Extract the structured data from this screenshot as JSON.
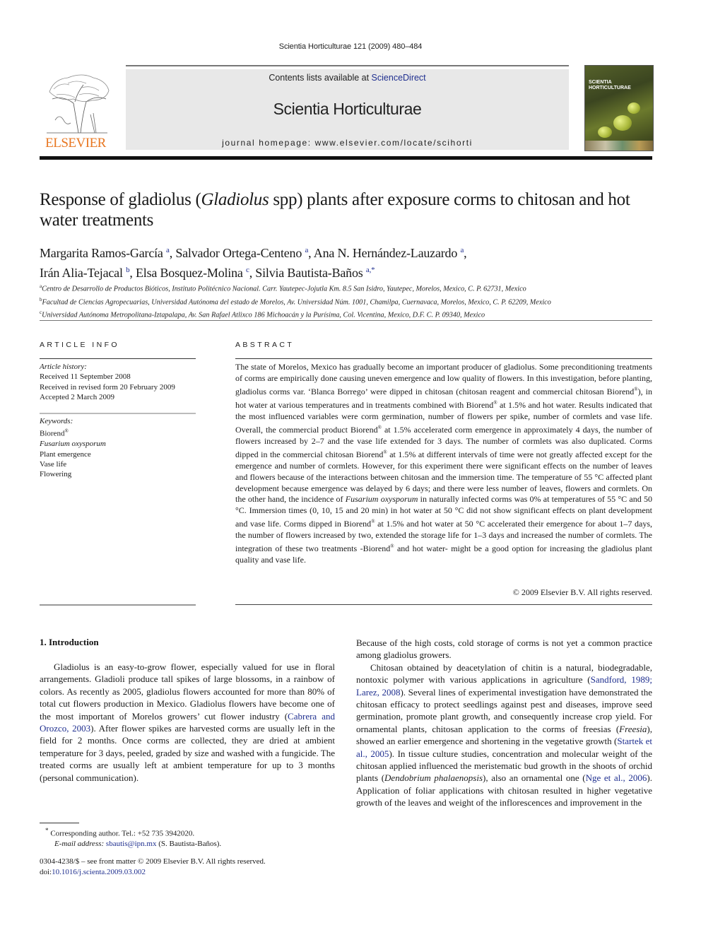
{
  "running_head": "Scientia Horticulturae 121 (2009) 480–484",
  "masthead": {
    "contents_prefix": "Contents lists available at ",
    "contents_link": "ScienceDirect",
    "journal_title": "Scientia Horticulturae",
    "homepage": "journal homepage: www.elsevier.com/locate/scihorti",
    "publisher_logo_text": "ELSEVIER",
    "cover_title_line1": "SCIENTIA",
    "cover_title_line2": "HORTICULTURAE"
  },
  "colors": {
    "link": "#1f2f8f",
    "elsevier_orange": "#e87722",
    "masthead_band": "#e8e8e8"
  },
  "article": {
    "title_part1": "Response of gladiolus (",
    "title_italic": "Gladiolus",
    "title_part2": " spp) plants after exposure corms to chitosan and hot water treatments",
    "authors": [
      {
        "name": "Margarita Ramos-García",
        "aff": "a",
        "sep": ", "
      },
      {
        "name": "Salvador Ortega-Centeno",
        "aff": "a",
        "sep": ", "
      },
      {
        "name": "Ana N. Hernández-Lauzardo",
        "aff": "a",
        "sep": ","
      },
      {
        "name": "Irán Alia-Tejacal",
        "aff": "b",
        "sep": ", "
      },
      {
        "name": "Elsa Bosquez-Molina",
        "aff": "c",
        "sep": ", "
      },
      {
        "name": "Silvia Bautista-Baños",
        "aff": "a,*",
        "sep": ""
      }
    ],
    "affiliations": [
      {
        "key": "a",
        "text": "Centro de Desarrollo de Productos Bióticos, Instituto Politécnico Nacional. Carr. Yautepec-Jojutla Km. 8.5 San Isidro, Yautepec, Morelos, Mexico, C. P. 62731, Mexico"
      },
      {
        "key": "b",
        "text": "Facultad de Ciencias Agropecuarias, Universidad Autónoma del estado de Morelos, Av. Universidad Núm. 1001, Chamilpa, Cuernavaca, Morelos, Mexico, C. P. 62209, Mexico"
      },
      {
        "key": "c",
        "text": "Universidad Autónoma Metropolitana-Iztapalapa, Av. San Rafael Atlixco 186 Michoacán y la Purísima, Col. Vicentina, Mexico, D.F. C. P. 09340, Mexico"
      }
    ]
  },
  "article_info": {
    "label": "ARTICLE INFO",
    "history_label": "Article history:",
    "history": [
      "Received 11 September 2008",
      "Received in revised form 20 February 2009",
      "Accepted 2 March 2009"
    ],
    "keywords_label": "Keywords:",
    "keywords": [
      {
        "text": "Biorend",
        "reg": "®",
        "italic": false
      },
      {
        "text": "Fusarium oxysporum",
        "reg": "",
        "italic": true
      },
      {
        "text": "Plant emergence",
        "reg": "",
        "italic": false
      },
      {
        "text": "Vase life",
        "reg": "",
        "italic": false
      },
      {
        "text": "Flowering",
        "reg": "",
        "italic": false
      }
    ]
  },
  "abstract": {
    "label": "ABSTRACT",
    "segments": [
      {
        "t": "The state of Morelos, Mexico has gradually become an important producer of gladiolus. Some preconditioning treatments of corms are empirically done causing uneven emergence and low quality of flowers. In this investigation, before planting, gladiolus corms var. ‘Blanca Borrego’ were dipped in chitosan (chitosan reagent and commercial chitosan Biorend"
      },
      {
        "t": "®",
        "sup": true
      },
      {
        "t": "), in hot water at various temperatures and in treatments combined with Biorend"
      },
      {
        "t": "®",
        "sup": true
      },
      {
        "t": " at 1.5% and hot water. Results indicated that the most influenced variables were corm germination, number of flowers per spike, number of cormlets and vase life. Overall, the commercial product Biorend"
      },
      {
        "t": "®",
        "sup": true
      },
      {
        "t": " at 1.5% accelerated corm emergence in approximately 4 days, the number of flowers increased by 2–7 and the vase life extended for 3 days. The number of cormlets was also duplicated. Corms dipped in the commercial chitosan Biorend"
      },
      {
        "t": "®",
        "sup": true
      },
      {
        "t": " at 1.5% at different intervals of time were not greatly affected except for the emergence and number of cormlets. However, for this experiment there were significant effects on the number of leaves and flowers because of the interactions between chitosan and the immersion time. The temperature of 55 °C affected plant development because emergence was delayed by 6 days; and there were less number of leaves, flowers and cormlets. On the other hand, the incidence of "
      },
      {
        "t": "Fusarium oxysporum",
        "it": true
      },
      {
        "t": " in naturally infected corms was 0% at temperatures of 55 °C and 50 °C. Immersion times (0, 10, 15 and 20 min) in hot water at 50 °C did not show significant effects on plant development and vase life. Corms dipped in Biorend"
      },
      {
        "t": "®",
        "sup": true
      },
      {
        "t": " at 1.5% and hot water at 50 °C accelerated their emergence for about 1–7 days, the number of flowers increased by two, extended the storage life for 1–3 days and increased the number of cormlets. The integration of these two treatments -Biorend"
      },
      {
        "t": "®",
        "sup": true
      },
      {
        "t": " and hot water- might be a good option for increasing the gladiolus plant quality and vase life."
      }
    ],
    "copyright": "© 2009 Elsevier B.V. All rights reserved."
  },
  "body": {
    "intro_heading": "1.  Introduction",
    "left_column": [
      {
        "t": "Gladiolus is an easy-to-grow flower, especially valued for use in floral arrangements. Gladioli produce tall spikes of large blossoms, in a rainbow of colors. As recently as 2005, gladiolus flowers accounted for more than 80% of total cut flowers production in Mexico. Gladiolus flowers have become one of the most important of Morelos growers’ cut flower industry ("
      },
      {
        "t": "Cabrera and Orozco, 2003",
        "link": true
      },
      {
        "t": "). After flower spikes are harvested corms are usually left in the field for 2 months. Once corms are collected, they are dried at ambient temperature for 3 days, peeled, graded by size and washed with a fungicide. The treated corms are usually left at ambient temperature for up to 3 months (personal communication)."
      }
    ],
    "right_column_p1": "Because of the high costs, cold storage of corms is not yet a common practice among gladiolus growers.",
    "right_column_p2": [
      {
        "t": "Chitosan obtained by deacetylation of chitin is a natural, biodegradable, nontoxic polymer with various applications in agriculture ("
      },
      {
        "t": "Sandford, 1989; Larez, 2008",
        "link": true
      },
      {
        "t": "). Several lines of experimental investigation have demonstrated the chitosan efficacy to protect seedlings against pest and diseases, improve seed germination, promote plant growth, and consequently increase crop yield. For ornamental plants, chitosan application to the corms of freesias ("
      },
      {
        "t": "Freesia",
        "it": true
      },
      {
        "t": "), showed an earlier emergence and shortening in the vegetative growth ("
      },
      {
        "t": "Startek et al., 2005",
        "link": true
      },
      {
        "t": "). In tissue culture studies, concentration and molecular weight of the chitosan applied influenced the meristematic bud growth in the shoots of orchid plants ("
      },
      {
        "t": "Dendobrium phalaenopsis",
        "it": true
      },
      {
        "t": "), also an ornamental one ("
      },
      {
        "t": "Nge et al., 2006",
        "link": true
      },
      {
        "t": "). Application of foliar applications with chitosan resulted in higher vegetative growth of the leaves and weight of the inflorescences and improvement in the"
      }
    ]
  },
  "footnote": {
    "marker": "*",
    "corresponding": "Corresponding author. Tel.: +52 735 3942020.",
    "email_label": "E-mail address:",
    "email": "sbautis@ipn.mx",
    "email_suffix": " (S. Bautista-Baños)."
  },
  "front_matter": {
    "issn_line": "0304-4238/$ – see front matter © 2009 Elsevier B.V. All rights reserved.",
    "doi_prefix": "doi:",
    "doi": "10.1016/j.scienta.2009.03.002"
  }
}
